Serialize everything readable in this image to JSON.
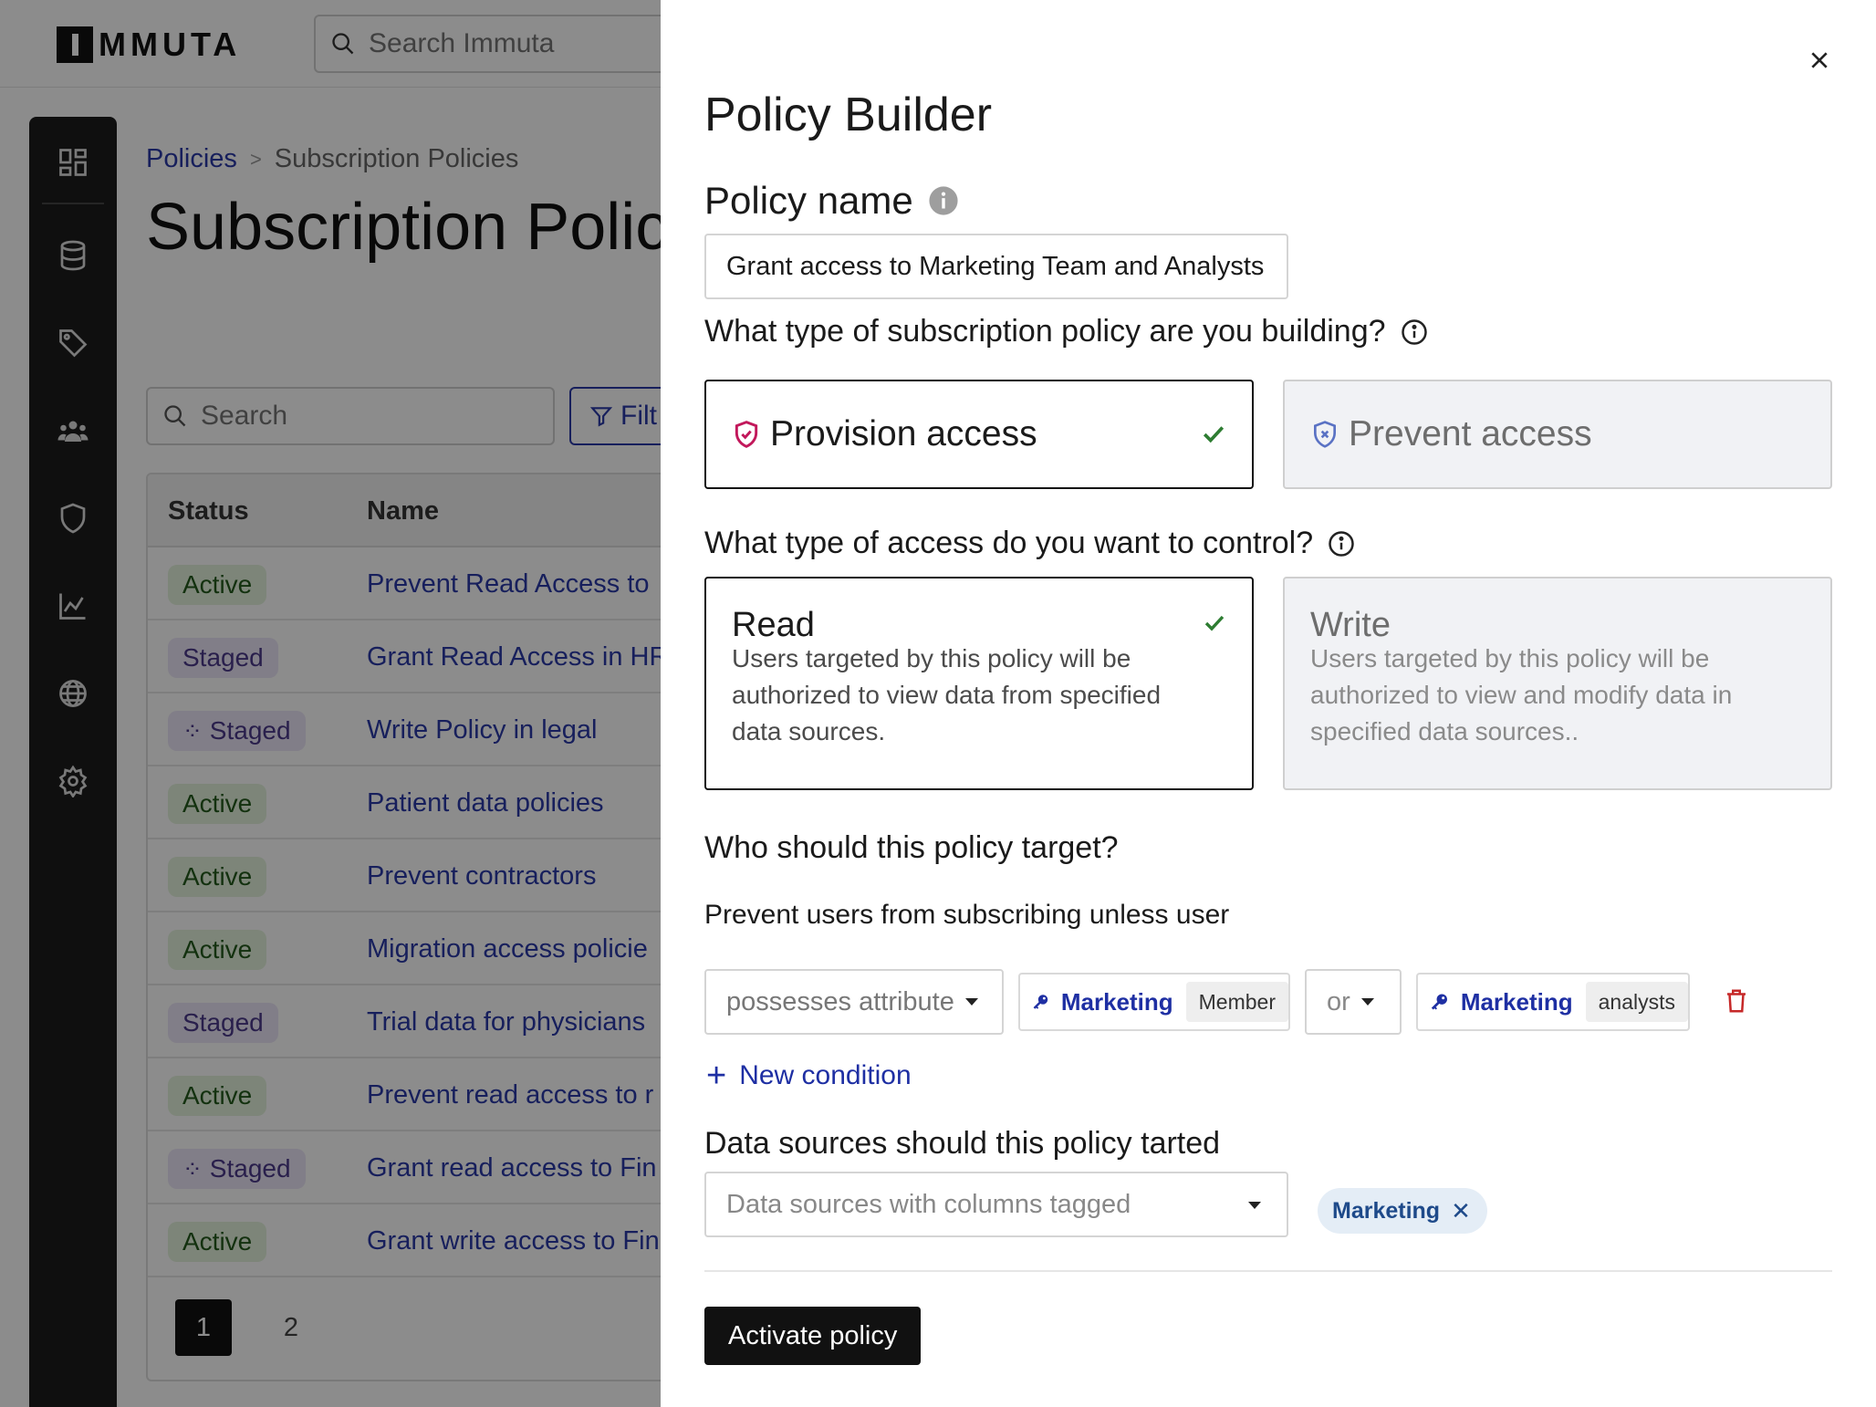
{
  "app": {
    "logo_text": "MMUTA",
    "search_placeholder": "Search Immuta",
    "nav": [
      "dashboard-icon",
      "database-icon",
      "tag-icon",
      "people-icon",
      "shield-icon",
      "chart-icon",
      "globe-icon",
      "gear-icon"
    ]
  },
  "page": {
    "breadcrumb": {
      "link": "Policies",
      "separator": ">",
      "current": "Subscription Policies"
    },
    "title": "Subscription Policies",
    "search_placeholder": "Search",
    "filter_label": "Filt",
    "table": {
      "headers": {
        "status": "Status",
        "name": "Name"
      },
      "rows": [
        {
          "status": "Active",
          "staged_pending": false,
          "name": "Prevent Read Access to"
        },
        {
          "status": "Staged",
          "staged_pending": false,
          "name": "Grant Read Access in HR"
        },
        {
          "status": "Staged",
          "staged_pending": true,
          "name": "Write Policy in legal"
        },
        {
          "status": "Active",
          "staged_pending": false,
          "name": "Patient data policies"
        },
        {
          "status": "Active",
          "staged_pending": false,
          "name": "Prevent contractors"
        },
        {
          "status": "Active",
          "staged_pending": false,
          "name": "Migration access policie"
        },
        {
          "status": "Staged",
          "staged_pending": false,
          "name": "Trial data for physicians"
        },
        {
          "status": "Active",
          "staged_pending": false,
          "name": "Prevent read access to r"
        },
        {
          "status": "Staged",
          "staged_pending": true,
          "name": "Grant read access to Fin"
        },
        {
          "status": "Active",
          "staged_pending": false,
          "name": "Grant write access to Fin"
        }
      ]
    },
    "pagination": {
      "pages": [
        "1",
        "2"
      ],
      "current": "1"
    }
  },
  "drawer": {
    "title": "Policy Builder",
    "close_label": "×",
    "policy_name_label": "Policy name",
    "policy_name_value": "Grant access to Marketing Team and Analysts",
    "policy_type_question": "What type of subscription policy are you building?",
    "policy_types": [
      {
        "label": "Provision access",
        "selected": true,
        "icon": "shield-check-icon"
      },
      {
        "label": "Prevent access",
        "selected": false,
        "icon": "shield-x-icon"
      }
    ],
    "access_type_question": "What type of access do you want to control?",
    "access_types": [
      {
        "label": "Read",
        "description": "Users targeted by this policy will be authorized to view data from specified data sources.",
        "selected": true
      },
      {
        "label": "Write",
        "description": "Users targeted by this policy will be authorized to view and modify data in specified data sources..",
        "selected": false
      }
    ],
    "target_question": "Who should this policy target?",
    "condition_intro": "Prevent users from subscribing unless user",
    "condition": {
      "operator_select": "possesses attribute",
      "attr1": {
        "name": "Marketing",
        "value": "Member"
      },
      "conjunction": "or",
      "attr2": {
        "name": "Marketing",
        "value": "analysts"
      }
    },
    "new_condition_label": "New condition",
    "data_sources_label": "Data sources should this policy tarted",
    "data_sources_select": "Data sources with columns tagged",
    "tag": "Marketing",
    "tag_remove": "✕",
    "activate_label": "Activate policy",
    "colors": {
      "accent": "#1e2fa3",
      "selected_border": "#111111",
      "check": "#2e7d32",
      "danger": "#c62828"
    }
  }
}
